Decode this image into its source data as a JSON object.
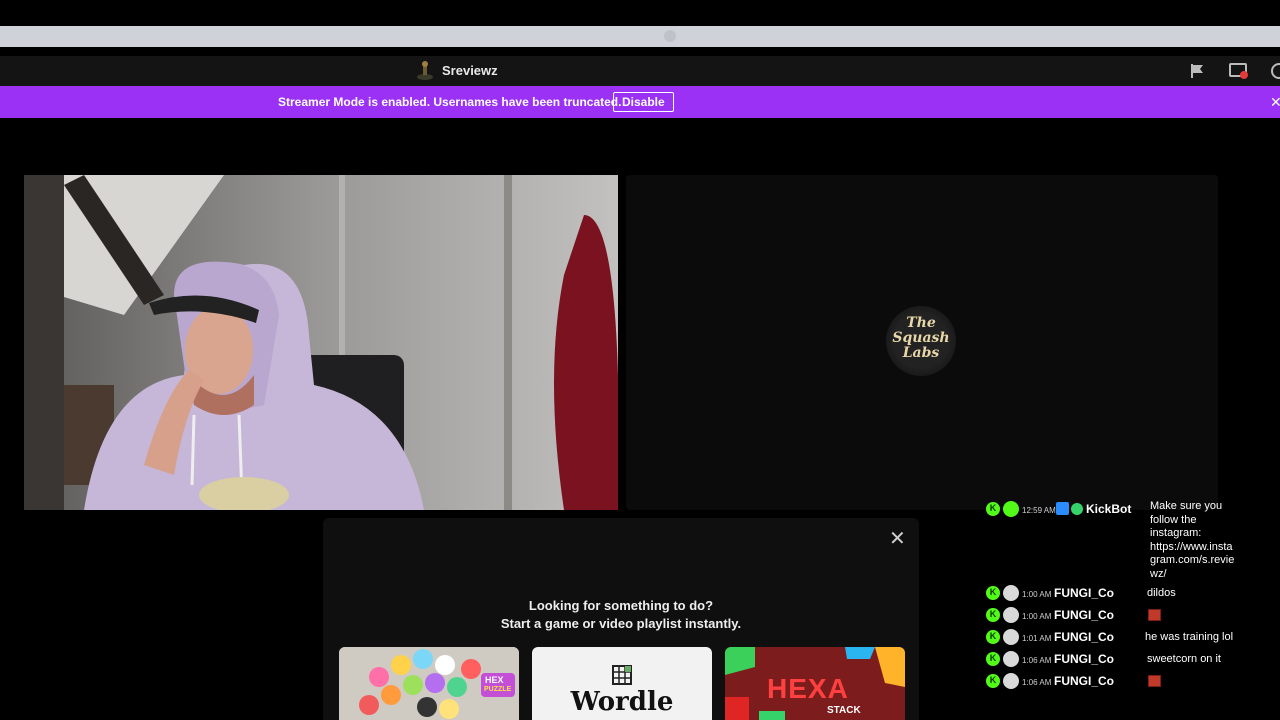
{
  "header": {
    "channel_name": "Sreviewz"
  },
  "banner": {
    "message": "Streamer Mode is enabled. Usernames have been truncated.",
    "disable_label": "Disable",
    "close_glyph": "✕"
  },
  "stream_logo": {
    "lines": [
      "The",
      "Squash",
      "Labs"
    ]
  },
  "activity": {
    "close_glyph": "✕",
    "heading": "Looking for something to do?",
    "subheading": "Start a game or video playlist instantly.",
    "cards": [
      {
        "name": "hex-puzzle",
        "label_top": "HEX",
        "label_bottom": "PUZZLE"
      },
      {
        "name": "wordle",
        "label": "Wordle"
      },
      {
        "name": "hexa-stack",
        "label_big": "HEXA",
        "label_small": "STACK"
      }
    ]
  },
  "chat": {
    "messages": [
      {
        "time": "12:59 AM",
        "user": "KickBot",
        "text_lines": [
          "Make sure you",
          "follow the",
          "instagram:",
          "https://www.insta",
          "gram.com/s.revie",
          "wz/"
        ]
      },
      {
        "time": "1:00 AM",
        "user": "FUNGI_Co",
        "text": "dildos"
      },
      {
        "time": "1:00 AM",
        "user": "FUNGI_Co",
        "emote": true
      },
      {
        "time": "1:01 AM",
        "user": "FUNGI_Co",
        "text": "he was training lol"
      },
      {
        "time": "1:06 AM",
        "user": "FUNGI_Co",
        "text": "sweetcorn on it"
      },
      {
        "time": "1:06 AM",
        "user": "FUNGI_Co",
        "emote": true
      }
    ],
    "badge_letter": "K"
  },
  "colors": {
    "banner": "#9b31f4",
    "kick_green": "#53fc18"
  }
}
